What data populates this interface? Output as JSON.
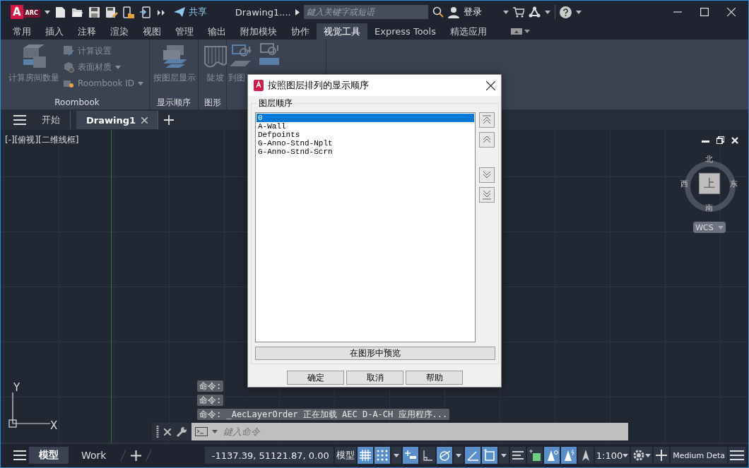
{
  "titlebar": {
    "logo": {
      "letter": "A",
      "badge": "ARC"
    },
    "share": "共享",
    "title": "Drawing1....",
    "search": {
      "placeholder": "鍵入关键字或短语"
    },
    "login": "登录"
  },
  "ribbon_tabs": [
    {
      "label": "常用",
      "selected": false
    },
    {
      "label": "插入",
      "selected": false
    },
    {
      "label": "注释",
      "selected": false
    },
    {
      "label": "渲染",
      "selected": false
    },
    {
      "label": "视图",
      "selected": false
    },
    {
      "label": "管理",
      "selected": false
    },
    {
      "label": "输出",
      "selected": false
    },
    {
      "label": "附加模块",
      "selected": false
    },
    {
      "label": "协作",
      "selected": false
    },
    {
      "label": "视觉工具",
      "selected": true
    },
    {
      "label": "Express Tools",
      "selected": false
    },
    {
      "label": "精选应用",
      "selected": false
    }
  ],
  "ribbon_panels": [
    {
      "title": "Roombook",
      "large": [
        {
          "label": "计算房间数量"
        }
      ],
      "small": [
        {
          "label": "计算设置",
          "dropdown": false
        },
        {
          "label": "表面材质",
          "dropdown": true
        },
        {
          "label": "Roombook ID",
          "dropdown": true
        }
      ]
    },
    {
      "title": "显示顺序",
      "large": [
        {
          "label": "按图层显示"
        }
      ]
    },
    {
      "title": "图形",
      "large": [
        {
          "label": "陡坡"
        }
      ]
    },
    {
      "large": [
        {
          "kind": "labelled",
          "label": "到图"
        },
        {
          "kind": "icon"
        }
      ]
    }
  ],
  "doc_tabs": [
    {
      "label": "开始",
      "selected": false
    },
    {
      "label": "Drawing1",
      "selected": true
    }
  ],
  "viewport_label": "[-][俯视][二维线框]",
  "viewcube": {
    "north": "北",
    "south": "南",
    "east": "东",
    "west": "西",
    "face": "上",
    "ucs": "WCS"
  },
  "ucs_icon": {
    "x": "X",
    "y": "Y"
  },
  "command_history": [
    "命令:",
    "命令:",
    "命令: _AecLayerOrder 正在加载 AEC D-A-CH 应用程序..."
  ],
  "command_input": {
    "placeholder": "鍵入命令"
  },
  "layout_tabs": [
    {
      "label": "模型",
      "selected": true
    },
    {
      "label": "Work",
      "selected": false
    }
  ],
  "status_bar": {
    "coordinates": "-1137.39, 51121.87, 0.00",
    "space": "模型",
    "toggles": [
      {
        "kind": "grid",
        "on": true
      },
      {
        "kind": "snap",
        "on": true
      },
      {
        "kind": "dropdown"
      },
      {
        "kind": "dynamic-input",
        "on": true
      },
      {
        "kind": "ortho",
        "on": false
      },
      {
        "kind": "polar",
        "on": true
      },
      {
        "kind": "dropdown"
      },
      {
        "kind": "tracking",
        "on": true
      },
      {
        "kind": "osnap",
        "on": true
      },
      {
        "kind": "dropdown"
      },
      {
        "kind": "lineweight",
        "on": false
      },
      {
        "kind": "transparency",
        "on": false
      },
      {
        "kind": "annotation-visibility",
        "on": true
      },
      {
        "kind": "auto-scale",
        "on": true
      },
      {
        "kind": "annotation-scale",
        "on": false
      }
    ],
    "scale": "1:100",
    "detail": "Medium Deta"
  },
  "dialog": {
    "title": "按照图层排列的显示顺序",
    "group": "图层顺序",
    "layers": [
      {
        "name": "0",
        "selected": true
      },
      {
        "name": "A-Wall",
        "selected": false
      },
      {
        "name": "Defpoints",
        "selected": false
      },
      {
        "name": "G-Anno-Stnd-Nplt",
        "selected": false
      },
      {
        "name": "G-Anno-Stnd-Scrn",
        "selected": false
      }
    ],
    "preview": "在图形中预览",
    "buttons": [
      "确定",
      "取消",
      "帮助"
    ]
  }
}
